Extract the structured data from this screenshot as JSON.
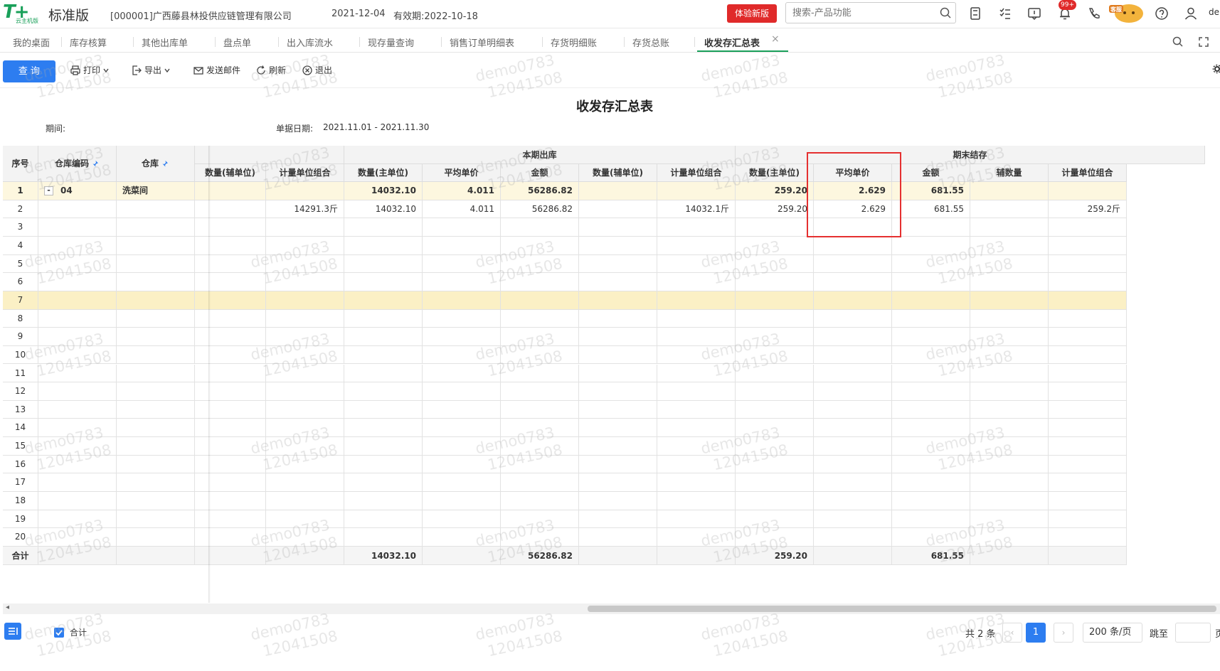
{
  "header": {
    "logo_text": "T+",
    "logo_sub": "云主机版",
    "edition": "标准版",
    "company": "[000001]广西藤县林投供应链管理有限公司",
    "date": "2021-12-04",
    "valid": "有效期:2022-10-18",
    "trial_label": "体验新版",
    "search_placeholder": "搜索-产品功能",
    "notif_count": "99+",
    "mascot_text": "客服",
    "user_text": "de"
  },
  "tabs": [
    {
      "label": "我的桌面"
    },
    {
      "label": "库存核算"
    },
    {
      "label": "其他出库单"
    },
    {
      "label": "盘点单"
    },
    {
      "label": "出入库流水"
    },
    {
      "label": "现存量查询"
    },
    {
      "label": "销售订单明细表"
    },
    {
      "label": "存货明细账"
    },
    {
      "label": "存货总账"
    },
    {
      "label": "收发存汇总表"
    }
  ],
  "tab_close": "×",
  "toolbar": {
    "query": "查 询",
    "print": "打印",
    "export": "导出",
    "email": "发送邮件",
    "refresh": "刷新",
    "exit": "退出"
  },
  "report": {
    "title": "收发存汇总表",
    "period_label": "期间:",
    "billdate_label": "单据日期:",
    "billdate_value": "2021.11.01 - 2021.11.30"
  },
  "grid": {
    "frozen_headers": [
      "序号",
      "仓库编码",
      "仓库"
    ],
    "group_headers": {
      "outbound": "本期出库",
      "ending": "期末结存"
    },
    "sub_headers": [
      "数量(辅单位)",
      "计量单位组合",
      "数量(主单位)",
      "平均单价",
      "金额",
      "数量(辅单位)",
      "计量单位组合",
      "数量(主单位)",
      "平均单价",
      "金额",
      "辅数量",
      "计量单位组合"
    ],
    "rows": [
      {
        "no": "1",
        "code": "04",
        "expand": "-",
        "name": "洗菜间",
        "c": [
          "",
          "",
          "14032.10",
          "4.011",
          "56286.82",
          "",
          "",
          "259.20",
          "2.629",
          "681.55",
          "",
          ""
        ]
      },
      {
        "no": "2",
        "code": "",
        "expand": "",
        "name": "",
        "c": [
          "",
          "14291.3斤",
          "14032.10",
          "4.011",
          "56286.82",
          "",
          "14032.1斤",
          "259.20",
          "2.629",
          "681.55",
          "",
          "259.2斤"
        ]
      },
      {
        "no": "3"
      },
      {
        "no": "4"
      },
      {
        "no": "5"
      },
      {
        "no": "6"
      },
      {
        "no": "7"
      },
      {
        "no": "8"
      },
      {
        "no": "9"
      },
      {
        "no": "10"
      },
      {
        "no": "11"
      },
      {
        "no": "12"
      },
      {
        "no": "13"
      },
      {
        "no": "14"
      },
      {
        "no": "15"
      },
      {
        "no": "16"
      },
      {
        "no": "17"
      },
      {
        "no": "18"
      },
      {
        "no": "19"
      },
      {
        "no": "20"
      }
    ],
    "total_label": "合计",
    "totals": [
      "",
      "",
      "14032.10",
      "",
      "56286.82",
      "",
      "",
      "259.20",
      "",
      "681.55",
      "",
      ""
    ]
  },
  "footer": {
    "total_checkbox_label": "合计",
    "pager_count": "共 2 条",
    "prev": "‹",
    "current_page": "1",
    "next": "›",
    "page_size": "200 条/页",
    "goto_label": "跳至",
    "page_suffix": "页"
  },
  "watermark": {
    "line1": "demo0783",
    "line2": "12041508"
  },
  "colors": {
    "accent": "#2d7df0",
    "brand": "#1aa05a",
    "trial": "#e02a2a",
    "highlight": "#e53030"
  }
}
